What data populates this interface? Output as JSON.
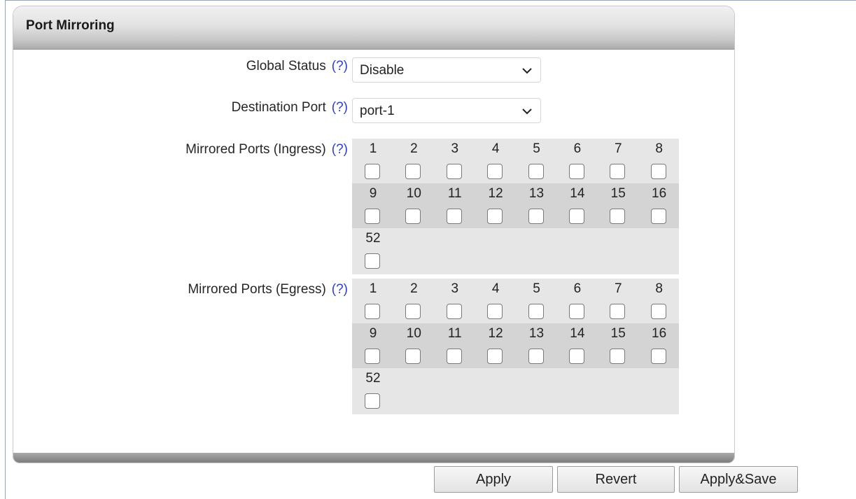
{
  "panel": {
    "title": "Port Mirroring"
  },
  "help_text": "(?)",
  "global_status": {
    "label": "Global Status",
    "value": "Disable"
  },
  "destination_port": {
    "label": "Destination Port",
    "value": "port-1"
  },
  "ingress": {
    "label": "Mirrored Ports (Ingress)",
    "rows": [
      [
        "1",
        "2",
        "3",
        "4",
        "5",
        "6",
        "7",
        "8"
      ],
      [
        "9",
        "10",
        "11",
        "12",
        "13",
        "14",
        "15",
        "16"
      ],
      [
        "52"
      ]
    ]
  },
  "egress": {
    "label": "Mirrored Ports (Egress)",
    "rows": [
      [
        "1",
        "2",
        "3",
        "4",
        "5",
        "6",
        "7",
        "8"
      ],
      [
        "9",
        "10",
        "11",
        "12",
        "13",
        "14",
        "15",
        "16"
      ],
      [
        "52"
      ]
    ]
  },
  "buttons": {
    "apply": "Apply",
    "revert": "Revert",
    "apply_save": "Apply&Save"
  },
  "icons": {
    "dropdown": "chevron-down-icon"
  },
  "colors": {
    "help_link": "#2b3fe0",
    "grid_row_light": "#e6e6e6",
    "grid_row_dark": "#d4d4d4"
  }
}
